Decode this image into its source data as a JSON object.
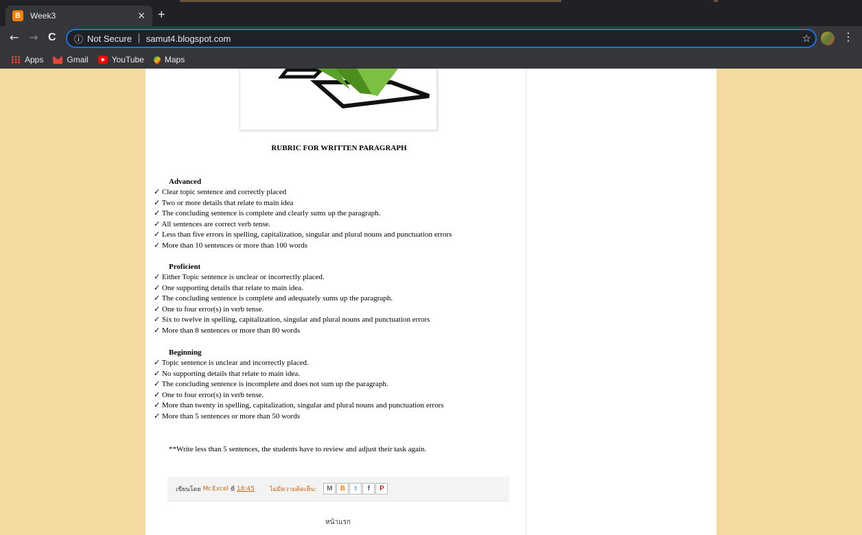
{
  "browser": {
    "tab_title": "Week3",
    "tab_icon_letter": "B",
    "close_glyph": "×",
    "new_tab_glyph": "+",
    "back_glyph": "←",
    "forward_glyph": "→",
    "reload_glyph": "C",
    "info_glyph": "ⓘ",
    "security_label": "Not Secure",
    "separator": "|",
    "url": "samut4.blogspot.com",
    "star_glyph": "☆",
    "menu_glyph": "⋮",
    "bookmarks": [
      {
        "label": "Apps",
        "icon": "apps-icon"
      },
      {
        "label": "Gmail",
        "icon": "gmail-icon"
      },
      {
        "label": "YouTube",
        "icon": "youtube-icon"
      },
      {
        "label": "Maps",
        "icon": "maps-icon"
      }
    ]
  },
  "post": {
    "title": "RUBRIC FOR WRITTEN PARAGRAPH",
    "check": "✓",
    "sections": [
      {
        "heading": "Advanced",
        "items": [
          "Clear topic sentence and correctly placed",
          "Two or more details that relate to main idea",
          "The concluding sentence is complete and clearly sums up the paragraph.",
          "All sentences are correct verb tense.",
          "Less than five errors in spelling, capitalization, singular and plural nouns and punctuation errors",
          "More than 10 sentences or more than 100 words"
        ]
      },
      {
        "heading": "Proficient",
        "items": [
          "Either Topic sentence is unclear or incorrectly placed.",
          "One supporting details that relate to main idea.",
          "The concluding sentence is complete and adequately sums up the paragraph.",
          "One to four error(s) in verb tense.",
          "Six to twelve in spelling, capitalization, singular and plural nouns and punctuation errors",
          "More than 8 sentences or more than 80 words"
        ]
      },
      {
        "heading": "Beginning",
        "items": [
          "Topic sentence is unclear and incorrectly placed.",
          "No supporting details that relate to main idea.",
          "The concluding sentence is incomplete and does not sum up the paragraph.",
          "One to four error(s) in verb tense.",
          "More than twenty in spelling, capitalization, singular and plural nouns and punctuation errors",
          "More than 5 sentences or more than 50 words"
        ]
      }
    ],
    "note": "**Write less than 5 sentences, the students have to review and adjust their task again."
  },
  "footer": {
    "posted_by": "เขียนโดย",
    "author": "Mr.Excel",
    "at": "ที่",
    "time": "18:45",
    "comments": "ไม่มีความคิดเห็น:",
    "share_buttons": [
      "M",
      "B",
      "t",
      "f",
      "P"
    ]
  },
  "home_link": "หน้าแรก",
  "colors": {
    "background": "#f4d9a0",
    "accent_link": "#cc6611",
    "check_green": "#5aa02c"
  }
}
